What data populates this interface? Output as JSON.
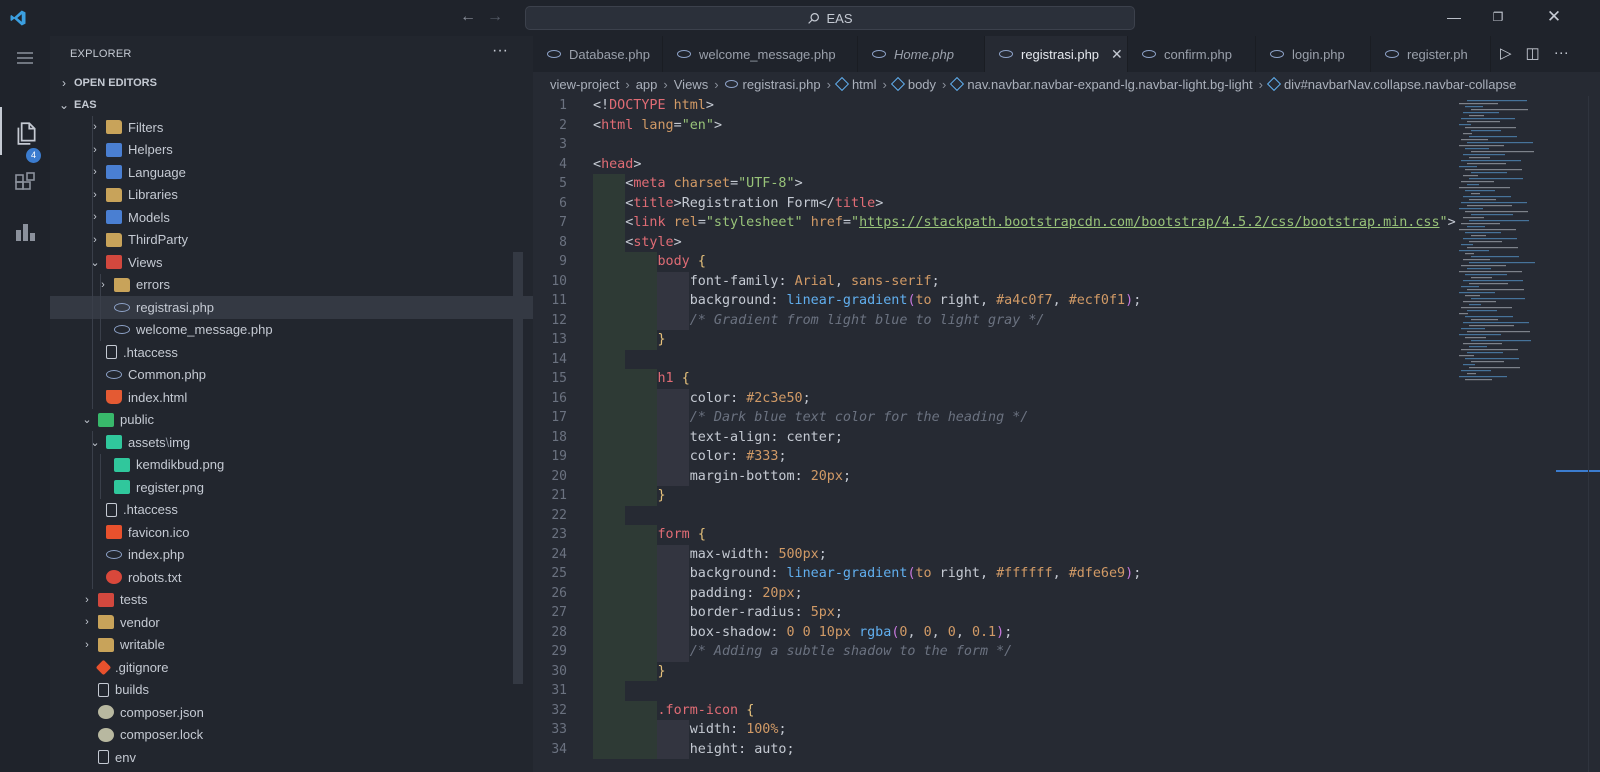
{
  "titlebar": {
    "search_text": "EAS"
  },
  "activitybar": {
    "extensions_badge": "4"
  },
  "sidebar": {
    "title": "EXPLORER",
    "more": "···",
    "open_editors_label": "OPEN EDITORS",
    "project_label": "EAS",
    "tree": [
      {
        "label": "Filters",
        "depth": 1,
        "kind": "folder",
        "icon": "folder-icon",
        "expanded": false
      },
      {
        "label": "Helpers",
        "depth": 1,
        "kind": "folder",
        "icon": "helpers-folder-icon",
        "expanded": false
      },
      {
        "label": "Language",
        "depth": 1,
        "kind": "folder",
        "icon": "language-folder-icon",
        "expanded": false
      },
      {
        "label": "Libraries",
        "depth": 1,
        "kind": "folder",
        "icon": "libraries-folder-icon",
        "expanded": false
      },
      {
        "label": "Models",
        "depth": 1,
        "kind": "folder",
        "icon": "models-folder-icon",
        "expanded": false
      },
      {
        "label": "ThirdParty",
        "depth": 1,
        "kind": "folder",
        "icon": "folder-icon",
        "expanded": false
      },
      {
        "label": "Views",
        "depth": 1,
        "kind": "folder",
        "icon": "views-folder-icon",
        "expanded": true
      },
      {
        "label": "errors",
        "depth": 2,
        "kind": "folder",
        "icon": "folder-icon",
        "expanded": false
      },
      {
        "label": "registrasi.php",
        "depth": 2,
        "kind": "file",
        "icon": "php-icon",
        "selected": true
      },
      {
        "label": "welcome_message.php",
        "depth": 2,
        "kind": "file",
        "icon": "php-icon"
      },
      {
        "label": ".htaccess",
        "depth": 1,
        "kind": "file",
        "icon": "file-icon"
      },
      {
        "label": "Common.php",
        "depth": 1,
        "kind": "file",
        "icon": "php-icon"
      },
      {
        "label": "index.html",
        "depth": 1,
        "kind": "file",
        "icon": "html5-icon"
      },
      {
        "label": "public",
        "depth": 0,
        "kind": "folder",
        "icon": "public-folder-icon",
        "expanded": true
      },
      {
        "label": "assets",
        "label_suffix": "img",
        "depth": 1,
        "kind": "folder",
        "icon": "images-folder-icon",
        "expanded": true
      },
      {
        "label": "kemdikbud.png",
        "depth": 2,
        "kind": "file",
        "icon": "image-icon"
      },
      {
        "label": "register.png",
        "depth": 2,
        "kind": "file",
        "icon": "image-icon"
      },
      {
        "label": ".htaccess",
        "depth": 1,
        "kind": "file",
        "icon": "file-icon"
      },
      {
        "label": "favicon.ico",
        "depth": 1,
        "kind": "file",
        "icon": "star-icon"
      },
      {
        "label": "index.php",
        "depth": 1,
        "kind": "file",
        "icon": "php-icon"
      },
      {
        "label": "robots.txt",
        "depth": 1,
        "kind": "file",
        "icon": "robot-icon"
      },
      {
        "label": "tests",
        "depth": 0,
        "kind": "folder",
        "icon": "tests-folder-icon",
        "expanded": false
      },
      {
        "label": "vendor",
        "depth": 0,
        "kind": "folder",
        "icon": "folder-icon",
        "expanded": false
      },
      {
        "label": "writable",
        "depth": 0,
        "kind": "folder",
        "icon": "folder-icon",
        "expanded": false
      },
      {
        "label": ".gitignore",
        "depth": 0,
        "kind": "file",
        "icon": "git-icon"
      },
      {
        "label": "builds",
        "depth": 0,
        "kind": "file",
        "icon": "file-icon"
      },
      {
        "label": "composer.json",
        "depth": 0,
        "kind": "file",
        "icon": "composer-icon"
      },
      {
        "label": "composer.lock",
        "depth": 0,
        "kind": "file",
        "icon": "composer-icon"
      },
      {
        "label": "env",
        "depth": 0,
        "kind": "file",
        "icon": "file-icon"
      }
    ]
  },
  "tabs": [
    {
      "label": "Database.php",
      "active": false,
      "italic": false
    },
    {
      "label": "welcome_message.php",
      "active": false,
      "italic": false
    },
    {
      "label": "Home.php",
      "active": false,
      "italic": true
    },
    {
      "label": "registrasi.php",
      "active": true,
      "italic": false
    },
    {
      "label": "confirm.php",
      "active": false,
      "italic": false
    },
    {
      "label": "login.php",
      "active": false,
      "italic": false
    },
    {
      "label": "register.ph",
      "active": false,
      "italic": false
    }
  ],
  "breadcrumb": [
    {
      "label": "view-project",
      "icon": ""
    },
    {
      "label": "app",
      "icon": ""
    },
    {
      "label": "Views",
      "icon": ""
    },
    {
      "label": "registrasi.php",
      "icon": "php-icon"
    },
    {
      "label": "html",
      "icon": "element-icon"
    },
    {
      "label": "body",
      "icon": "element-icon"
    },
    {
      "label": "nav.navbar.navbar-expand-lg.navbar-light.bg-light",
      "icon": "element-icon"
    },
    {
      "label": "div#navbarNav.collapse.navbar-collapse",
      "icon": "element-icon"
    }
  ],
  "code_lines": [
    {
      "n": "1",
      "html": "<span class='t-pun'>&lt;!</span><span class='t-kw'>DOCTYPE</span> <span class='t-attr'>html</span><span class='t-pun'>&gt;</span>"
    },
    {
      "n": "2",
      "html": "<span class='t-pun'>&lt;</span><span class='t-tag'>html</span> <span class='t-attr'>lang</span>=<span class='t-str'>\"en\"</span><span class='t-pun'>&gt;</span>"
    },
    {
      "n": "3",
      "html": ""
    },
    {
      "n": "4",
      "html": "<span class='t-pun'>&lt;</span><span class='t-tag'>head</span><span class='t-pun'>&gt;</span>"
    },
    {
      "n": "5",
      "html": "    <span class='t-pun'>&lt;</span><span class='t-tag'>meta</span> <span class='t-attr'>charset</span>=<span class='t-str'>\"UTF-8\"</span><span class='t-pun'>&gt;</span>"
    },
    {
      "n": "6",
      "html": "    <span class='t-pun'>&lt;</span><span class='t-tag'>title</span><span class='t-pun'>&gt;</span>Registration Form<span class='t-pun'>&lt;/</span><span class='t-tag'>title</span><span class='t-pun'>&gt;</span>"
    },
    {
      "n": "7",
      "html": "    <span class='t-pun'>&lt;</span><span class='t-tag'>link</span> <span class='t-attr'>rel</span>=<span class='t-str'>\"stylesheet\"</span> <span class='t-attr'>href</span>=<span class='t-str'>\"</span><span class='t-url'>https://stackpath.bootstrapcdn.com/bootstrap/4.5.2/css/bootstrap.min.css</span><span class='t-str'>\"</span><span class='t-pun'>&gt;</span>"
    },
    {
      "n": "8",
      "html": "    <span class='t-pun'>&lt;</span><span class='t-tag'>style</span><span class='t-pun'>&gt;</span>"
    },
    {
      "n": "9",
      "html": "        <span class='t-sel'>body</span> <span class='t-brace'>{</span>"
    },
    {
      "n": "10",
      "html": "            <span class='t-prop'>font-family</span>: <span class='t-num'>Arial</span>, <span class='t-num'>sans-serif</span>;"
    },
    {
      "n": "11",
      "html": "            <span class='t-prop'>background</span>: <span class='t-fn'>linear-gradient</span><span class='t-paren'>(</span><span class='t-num'>to</span> right, <span class='t-num'>#a4c0f7</span>, <span class='t-num'>#ecf0f1</span><span class='t-paren'>)</span>;"
    },
    {
      "n": "12",
      "html": "            <span class='t-cm'>/* Gradient from light blue to light gray */</span>"
    },
    {
      "n": "13",
      "html": "        <span class='t-brace'>}</span>"
    },
    {
      "n": "14",
      "html": ""
    },
    {
      "n": "15",
      "html": "        <span class='t-sel'>h1</span> <span class='t-brace'>{</span>"
    },
    {
      "n": "16",
      "html": "            <span class='t-prop'>color</span>: <span class='t-num'>#2c3e50</span>;"
    },
    {
      "n": "17",
      "html": "            <span class='t-cm'>/* Dark blue text color for the heading */</span>"
    },
    {
      "n": "18",
      "html": "            <span class='t-prop'>text-align</span>: center;"
    },
    {
      "n": "19",
      "html": "            <span class='t-prop'>color</span>: <span class='t-num'>#333</span>;"
    },
    {
      "n": "20",
      "html": "            <span class='t-prop'>margin-bottom</span>: <span class='t-num'>20px</span>;"
    },
    {
      "n": "21",
      "html": "        <span class='t-brace'>}</span>"
    },
    {
      "n": "22",
      "html": ""
    },
    {
      "n": "23",
      "html": "        <span class='t-sel'>form</span> <span class='t-brace'>{</span>"
    },
    {
      "n": "24",
      "html": "            <span class='t-prop'>max-width</span>: <span class='t-num'>500px</span>;"
    },
    {
      "n": "25",
      "html": "            <span class='t-prop'>background</span>: <span class='t-fn'>linear-gradient</span><span class='t-paren'>(</span><span class='t-num'>to</span> right, <span class='t-num'>#ffffff</span>, <span class='t-num'>#dfe6e9</span><span class='t-paren'>)</span>;"
    },
    {
      "n": "26",
      "html": "            <span class='t-prop'>padding</span>: <span class='t-num'>20px</span>;"
    },
    {
      "n": "27",
      "html": "            <span class='t-prop'>border-radius</span>: <span class='t-num'>5px</span>;"
    },
    {
      "n": "28",
      "html": "            <span class='t-prop'>box-shadow</span>: <span class='t-num'>0</span> <span class='t-num'>0</span> <span class='t-num'>10px</span> <span class='t-fn'>rgba</span><span class='t-paren'>(</span><span class='t-num'>0</span>, <span class='t-num'>0</span>, <span class='t-num'>0</span>, <span class='t-num'>0.1</span><span class='t-paren'>)</span>;"
    },
    {
      "n": "29",
      "html": "            <span class='t-cm'>/* Adding a subtle shadow to the form */</span>"
    },
    {
      "n": "30",
      "html": "        <span class='t-brace'>}</span>"
    },
    {
      "n": "31",
      "html": ""
    },
    {
      "n": "32",
      "html": "        <span class='t-sel'>.form-icon</span> <span class='t-brace'>{</span>"
    },
    {
      "n": "33",
      "html": "            <span class='t-prop'>width</span>: <span class='t-num'>100%</span>;"
    },
    {
      "n": "34",
      "html": "            <span class='t-prop'>height</span>: auto;"
    }
  ],
  "colors": {
    "accent": "#3b7ccf",
    "php_icon": "#8ea3c9",
    "folder": "#c8a35a"
  }
}
